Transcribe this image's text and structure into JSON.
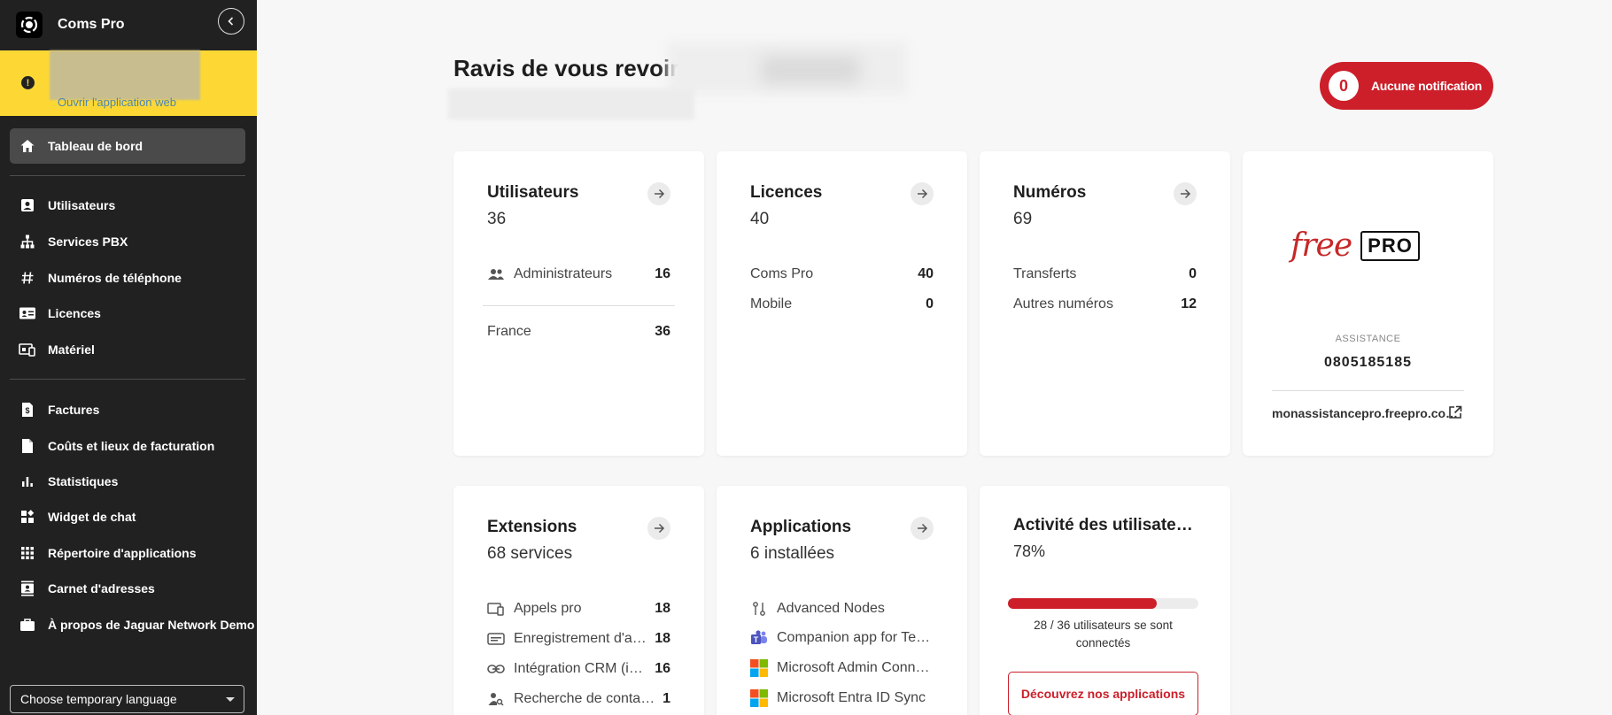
{
  "app": {
    "title": "Coms Pro"
  },
  "banner": {
    "link": "Ouvrir l'application web"
  },
  "sidebar": {
    "items": [
      {
        "label": "Tableau de bord",
        "icon": "home-icon"
      },
      {
        "label": "Utilisateurs",
        "icon": "user-card-icon"
      },
      {
        "label": "Services PBX",
        "icon": "hierarchy-icon"
      },
      {
        "label": "Numéros de téléphone",
        "icon": "hash-icon"
      },
      {
        "label": "Licences",
        "icon": "license-icon"
      },
      {
        "label": "Matériel",
        "icon": "devices-icon"
      },
      {
        "label": "Factures",
        "icon": "invoice-icon"
      },
      {
        "label": "Coûts et lieux de facturation",
        "icon": "document-icon"
      },
      {
        "label": "Statistiques",
        "icon": "bar-chart-icon"
      },
      {
        "label": "Widget de chat",
        "icon": "widget-icon"
      },
      {
        "label": "Répertoire d'applications",
        "icon": "apps-grid-icon"
      },
      {
        "label": "Carnet d'adresses",
        "icon": "contacts-icon"
      },
      {
        "label": "À propos de Jaguar Network Demo",
        "icon": "briefcase-icon"
      }
    ],
    "language": "Choose temporary language"
  },
  "header": {
    "greeting": "Ravis de vous revoir",
    "notification_count": "0",
    "notification_label": "Aucune notification"
  },
  "cards": {
    "users": {
      "title": "Utilisateurs",
      "count": "36",
      "rows": [
        {
          "label": "Administrateurs",
          "value": "16"
        },
        {
          "label": "France",
          "value": "36"
        }
      ]
    },
    "licences": {
      "title": "Licences",
      "count": "40",
      "rows": [
        {
          "label": "Coms Pro",
          "value": "40"
        },
        {
          "label": "Mobile",
          "value": "0"
        }
      ]
    },
    "numbers": {
      "title": "Numéros",
      "count": "69",
      "rows": [
        {
          "label": "Transferts",
          "value": "0"
        },
        {
          "label": "Autres numéros",
          "value": "12"
        }
      ]
    },
    "support": {
      "brand_word": "free",
      "brand_box": "PRO",
      "assistance_label": "ASSISTANCE",
      "phone": "0805185185",
      "link": "monassistancepro.freepro.co…"
    },
    "extensions": {
      "title": "Extensions",
      "count": "68 services",
      "rows": [
        {
          "label": "Appels pro",
          "value": "18"
        },
        {
          "label": "Enregistrement d'a…",
          "value": "18"
        },
        {
          "label": "Intégration CRM (i…",
          "value": "16"
        },
        {
          "label": "Recherche de conta…",
          "value": "1"
        }
      ]
    },
    "applications": {
      "title": "Applications",
      "count": "6 installées",
      "rows": [
        {
          "label": "Advanced Nodes"
        },
        {
          "label": "Companion app for Tea…"
        },
        {
          "label": "Microsoft Admin Conne…"
        },
        {
          "label": "Microsoft Entra ID Sync"
        }
      ]
    },
    "activity": {
      "title": "Activité des utilisate…",
      "percent": "78%",
      "progress": 0.78,
      "connected_text": "28 / 36 utilisateurs se sont connectés",
      "cta": "Découvrez nos applications"
    }
  },
  "colors": {
    "accent": "#cc1f2a",
    "sidebar": "#212121",
    "banner": "#fdd835"
  }
}
